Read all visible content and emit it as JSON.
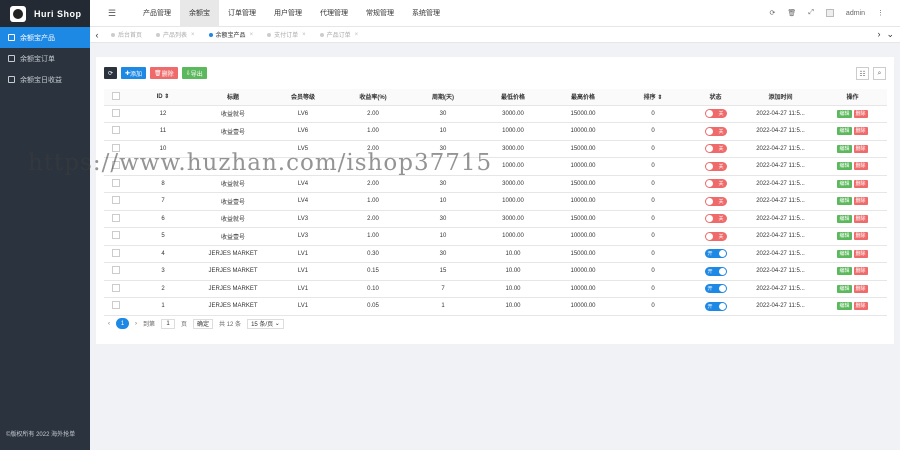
{
  "app": {
    "title": "Huri Shop"
  },
  "sidebar": {
    "items": [
      {
        "label": "余额宝产品",
        "active": true
      },
      {
        "label": "余额宝订单",
        "active": false
      },
      {
        "label": "余额宝日收益",
        "active": false
      }
    ],
    "copyright": "©版权所有 2022 海外抢单"
  },
  "topnav": {
    "tabs": [
      {
        "label": "产品管理",
        "active": false
      },
      {
        "label": "余额宝",
        "active": true
      },
      {
        "label": "订单管理",
        "active": false
      },
      {
        "label": "用户管理",
        "active": false
      },
      {
        "label": "代理管理",
        "active": false
      },
      {
        "label": "常规管理",
        "active": false
      },
      {
        "label": "系统管理",
        "active": false
      }
    ],
    "user": "admin"
  },
  "tabstrip": {
    "tabs": [
      {
        "label": "后台首页",
        "active": false
      },
      {
        "label": "产品列表",
        "active": false
      },
      {
        "label": "余额宝产品",
        "active": true
      },
      {
        "label": "支付订单",
        "active": false
      },
      {
        "label": "产品订单",
        "active": false
      }
    ]
  },
  "toolbar": {
    "add": "添加",
    "delete": "删除",
    "export": "导出"
  },
  "table": {
    "headers": [
      "ID",
      "标题",
      "会员等级",
      "收益率(%)",
      "周期(天)",
      "最低价格",
      "最高价格",
      "排序",
      "状态",
      "添加时间",
      "操作"
    ],
    "rows": [
      {
        "id": "12",
        "title": "收益就号",
        "level": "LV6",
        "rate": "2.00",
        "days": "30",
        "min": "3000.00",
        "max": "15000.00",
        "sort": "0",
        "status": "关",
        "on": false,
        "time": "2022-04-27 11:5..."
      },
      {
        "id": "11",
        "title": "收益壹号",
        "level": "LV6",
        "rate": "1.00",
        "days": "10",
        "min": "1000.00",
        "max": "10000.00",
        "sort": "0",
        "status": "关",
        "on": false,
        "time": "2022-04-27 11:5..."
      },
      {
        "id": "10",
        "title": "",
        "level": "LV5",
        "rate": "2.00",
        "days": "30",
        "min": "3000.00",
        "max": "15000.00",
        "sort": "0",
        "status": "关",
        "on": false,
        "time": "2022-04-27 11:5..."
      },
      {
        "id": "",
        "title": "",
        "level": "",
        "rate": "",
        "days": "",
        "min": "1000.00",
        "max": "10000.00",
        "sort": "0",
        "status": "关",
        "on": false,
        "time": "2022-04-27 11:5..."
      },
      {
        "id": "8",
        "title": "收益就号",
        "level": "LV4",
        "rate": "2.00",
        "days": "30",
        "min": "3000.00",
        "max": "15000.00",
        "sort": "0",
        "status": "关",
        "on": false,
        "time": "2022-04-27 11:5..."
      },
      {
        "id": "7",
        "title": "收益壹号",
        "level": "LV4",
        "rate": "1.00",
        "days": "10",
        "min": "1000.00",
        "max": "10000.00",
        "sort": "0",
        "status": "关",
        "on": false,
        "time": "2022-04-27 11:5..."
      },
      {
        "id": "6",
        "title": "收益就号",
        "level": "LV3",
        "rate": "2.00",
        "days": "30",
        "min": "3000.00",
        "max": "15000.00",
        "sort": "0",
        "status": "关",
        "on": false,
        "time": "2022-04-27 11:5..."
      },
      {
        "id": "5",
        "title": "收益壹号",
        "level": "LV3",
        "rate": "1.00",
        "days": "10",
        "min": "1000.00",
        "max": "10000.00",
        "sort": "0",
        "status": "关",
        "on": false,
        "time": "2022-04-27 11:5..."
      },
      {
        "id": "4",
        "title": "JERJES MARKET",
        "level": "LV1",
        "rate": "0.30",
        "days": "30",
        "min": "10.00",
        "max": "15000.00",
        "sort": "0",
        "status": "开",
        "on": true,
        "time": "2022-04-27 11:5..."
      },
      {
        "id": "3",
        "title": "JERJES MARKET",
        "level": "LV1",
        "rate": "0.15",
        "days": "15",
        "min": "10.00",
        "max": "10000.00",
        "sort": "0",
        "status": "开",
        "on": true,
        "time": "2022-04-27 11:5..."
      },
      {
        "id": "2",
        "title": "JERJES MARKET",
        "level": "LV1",
        "rate": "0.10",
        "days": "7",
        "min": "10.00",
        "max": "10000.00",
        "sort": "0",
        "status": "开",
        "on": true,
        "time": "2022-04-27 11:5..."
      },
      {
        "id": "1",
        "title": "JERJES MARKET",
        "level": "LV1",
        "rate": "0.05",
        "days": "1",
        "min": "10.00",
        "max": "10000.00",
        "sort": "0",
        "status": "开",
        "on": true,
        "time": "2022-04-27 11:5..."
      }
    ],
    "ops": {
      "edit": "编辑",
      "delete": "删除"
    }
  },
  "pager": {
    "current": "1",
    "goto_label": "到第",
    "goto_value": "1",
    "page_unit": "页",
    "confirm": "确定",
    "total": "共 12 条",
    "page_size": "15 条/页"
  },
  "watermark": "https://www.huzhan.com/ishop37715"
}
